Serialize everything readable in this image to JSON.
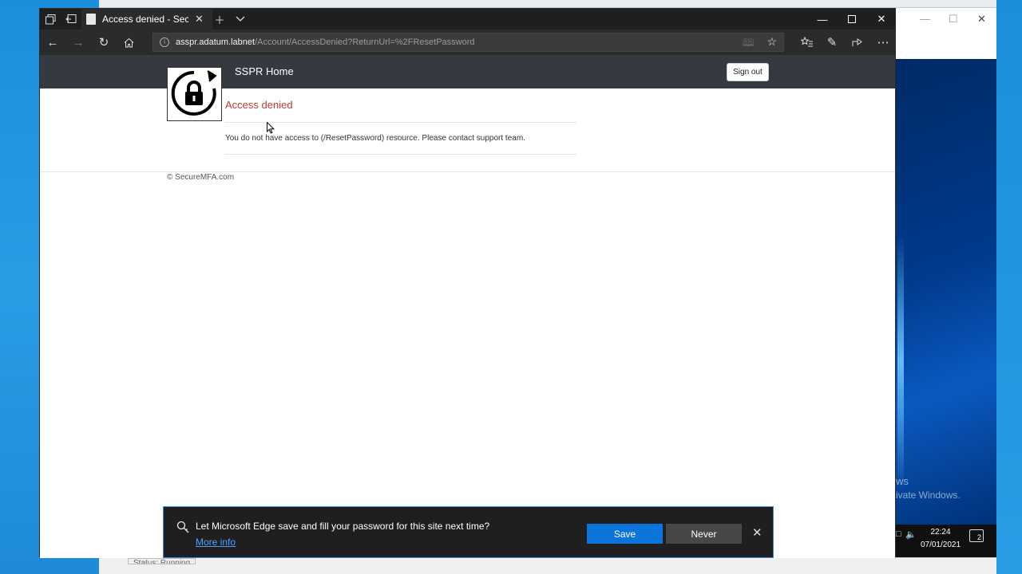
{
  "browser": {
    "tab": {
      "title": "Access denied - SecureM"
    },
    "address": {
      "domain": "asspr.adatum.labnet",
      "path": "/Account/AccessDenied?ReturnUrl=%2FResetPassword"
    },
    "icons": [
      "tab-manager-icon",
      "tab-aside-icon",
      "new-tab-icon",
      "tab-list-icon",
      "minimize-icon",
      "maximize-icon",
      "close-icon",
      "back-icon",
      "forward-icon",
      "refresh-icon",
      "home-icon",
      "info-icon",
      "reading-view-icon",
      "favorite-star-icon",
      "favorites-hub-icon",
      "pen-icon",
      "share-icon",
      "more-icon"
    ]
  },
  "site": {
    "brand": "SSPR Home",
    "signout_label": "Sign out",
    "title": "Access denied",
    "message": "You do not have access to (/ResetPassword) resource. Please contact support team.",
    "footer": "© SecureMFA.com"
  },
  "prompt": {
    "message": "Let Microsoft Edge save and fill your password for this site next time?",
    "more_info": "More info",
    "save_label": "Save",
    "never_label": "Never"
  },
  "desktop": {
    "watermark_line1": "ws",
    "watermark_line2": "ivate Windows.",
    "clock_time": "22:24",
    "clock_date": "07/01/2021",
    "notification_count": "2",
    "bg_status": "Status: Running"
  },
  "colors": {
    "accent": "#0a74da",
    "error_title": "#c0392b",
    "header_bg": "#343a40",
    "browser_chrome": "#2b2b2b"
  }
}
